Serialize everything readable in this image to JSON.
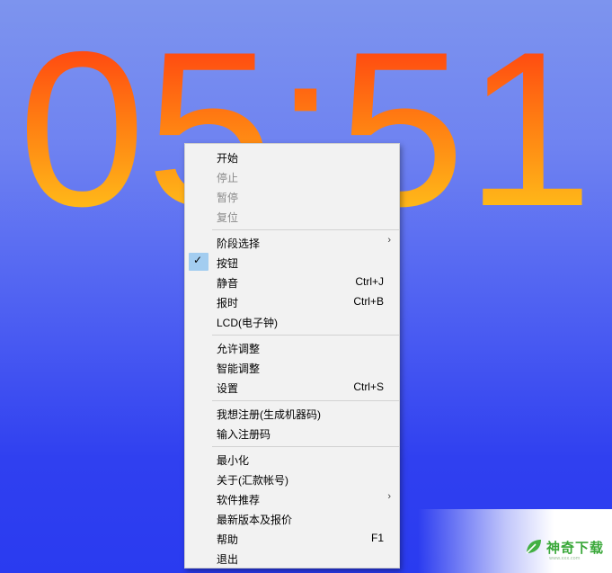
{
  "clock": {
    "time_text": "05:51"
  },
  "menu": {
    "items": [
      {
        "label": "开始",
        "shortcut": "",
        "disabled": false
      },
      {
        "label": "停止",
        "shortcut": "",
        "disabled": true
      },
      {
        "label": "暂停",
        "shortcut": "",
        "disabled": true
      },
      {
        "label": "复位",
        "shortcut": "",
        "disabled": true
      },
      {
        "label": "阶段选择",
        "shortcut": "",
        "submenu": true
      },
      {
        "label": "按钮",
        "shortcut": "",
        "checked": true
      },
      {
        "label": "静音",
        "shortcut": "Ctrl+J"
      },
      {
        "label": "报时",
        "shortcut": "Ctrl+B"
      },
      {
        "label": "LCD(电子钟)",
        "shortcut": ""
      },
      {
        "label": "允许调整",
        "shortcut": ""
      },
      {
        "label": "智能调整",
        "shortcut": ""
      },
      {
        "label": "设置",
        "shortcut": "Ctrl+S"
      },
      {
        "label": "我想注册(生成机器码)",
        "shortcut": ""
      },
      {
        "label": "输入注册码",
        "shortcut": ""
      },
      {
        "label": "最小化",
        "shortcut": ""
      },
      {
        "label": "关于(汇款帐号)",
        "shortcut": ""
      },
      {
        "label": "软件推荐",
        "shortcut": "",
        "submenu": true
      },
      {
        "label": "最新版本及报价",
        "shortcut": ""
      },
      {
        "label": "帮助",
        "shortcut": "F1"
      },
      {
        "label": "退出",
        "shortcut": ""
      }
    ],
    "submenu_arrow": "›",
    "check_glyph": "✓"
  },
  "watermark": {
    "text": "神奇下载",
    "sub": "www.xxx.com",
    "icon": "leaf-logo-icon"
  },
  "colors": {
    "clock_top": "#ff3a0e",
    "clock_bottom": "#ffd21a",
    "menu_bg": "#f2f2f2",
    "check_bg": "#a3cdf0"
  }
}
